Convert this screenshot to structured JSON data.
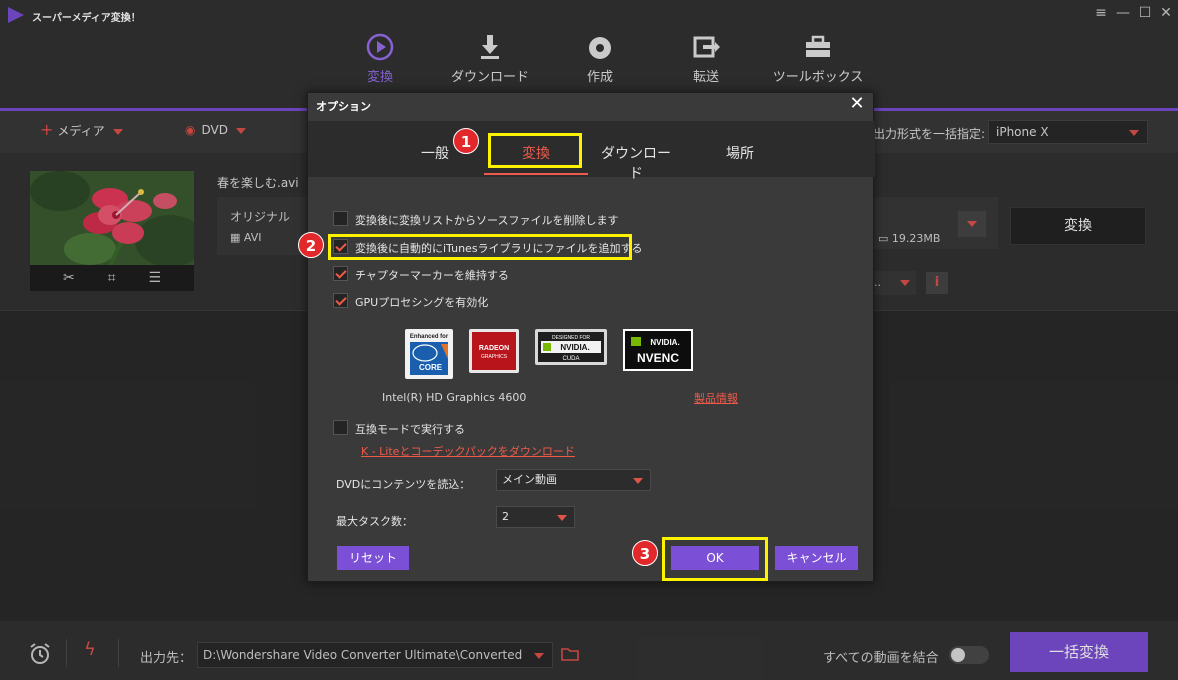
{
  "app": {
    "title": "スーパーメディア変換！",
    "window_controls": [
      "≡",
      "—",
      "☐",
      "✕"
    ]
  },
  "nav": [
    {
      "label": "変換",
      "icon": "convert-icon",
      "active": true
    },
    {
      "label": "ダウンロード",
      "icon": "download-icon",
      "active": false
    },
    {
      "label": "作成",
      "icon": "disc-icon",
      "active": false
    },
    {
      "label": "転送",
      "icon": "transfer-icon",
      "active": false
    },
    {
      "label": "ツールボックス",
      "icon": "toolbox-icon",
      "active": false
    }
  ],
  "toolbar": {
    "add_media": "メディア",
    "dvd": "DVD",
    "output_format_label": "出力形式を一括指定:",
    "output_format_value": "iPhone X"
  },
  "file": {
    "name": "春を楽しむ.avi",
    "original_label": "オリジナル",
    "original_format": "AVI",
    "target_size": "19.23MB",
    "convert_label": "変換",
    "subtitle_value": "..",
    "info_glyph": "i"
  },
  "dialog": {
    "title": "オプション",
    "close": "✕",
    "tabs": [
      {
        "label": "一般",
        "active": false
      },
      {
        "label": "変換",
        "active": true
      },
      {
        "label": "ダウンロード",
        "active": false
      },
      {
        "label": "場所",
        "active": false
      }
    ],
    "checkboxes": [
      {
        "label": "変換後に変換リストからソースファイルを削除します",
        "checked": false
      },
      {
        "label": "変換後に自動的にiTunesライブラリにファイルを追加する",
        "checked": true
      },
      {
        "label": "チャプターマーカーを維持する",
        "checked": true
      },
      {
        "label": "GPUプロセシングを有効化",
        "checked": true
      }
    ],
    "gpu_logos": {
      "intel_top": "Enhanced for",
      "intel_core": "CORE",
      "radeon": "RADEON",
      "radeon_sub": "GRAPHICS",
      "cuda_top": "DESIGNED FOR",
      "cuda_name": "NVIDIA.",
      "cuda_sub": "CUDA",
      "nvenc_top": "NVIDIA.",
      "nvenc_name": "NVENC"
    },
    "gpu_name": "Intel(R) HD Graphics 4600",
    "product_info_link": "製品情報",
    "compat_mode": {
      "label": "互換モードで実行する",
      "checked": false
    },
    "codec_link": "K - Liteとコーデックパックをダウンロード",
    "dvd_load_label": "DVDにコンテンツを読込：",
    "dvd_load_value": "メイン動画",
    "max_tasks_label": "最大タスク数：",
    "max_tasks_value": "2",
    "reset_label": "リセット",
    "ok_label": "OK",
    "cancel_label": "キャンセル"
  },
  "annotations": [
    "1",
    "2",
    "3"
  ],
  "bottom": {
    "output_label": "出力先：",
    "output_path": "D:\\Wondershare Video Converter Ultimate\\Converted",
    "merge_label": "すべての動画を結合",
    "merge_enabled": false,
    "batch_convert": "一括変換"
  },
  "colors": {
    "accent": "#7b4fd6",
    "highlight": "#ef5a4a",
    "annotation_frame": "#fdf200",
    "step_badge": "#e3282b"
  }
}
